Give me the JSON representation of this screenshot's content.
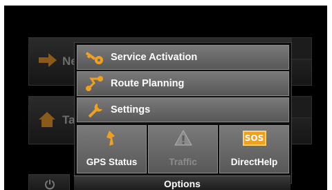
{
  "background": {
    "buttons": [
      {
        "label": "Ne",
        "icon": "arrow-right-icon"
      },
      {
        "label": "Ta",
        "icon": "home-icon"
      }
    ],
    "bottom_icon": "power-icon"
  },
  "popup": {
    "rows": [
      {
        "label": "Service Activation",
        "icon": "key-icon"
      },
      {
        "label": "Route Planning",
        "icon": "route-icon"
      },
      {
        "label": "Settings",
        "icon": "wrench-icon"
      }
    ],
    "tiles": [
      {
        "label": "GPS Status",
        "icon": "satellite-icon",
        "enabled": true
      },
      {
        "label": "Traffic",
        "icon": "warning-icon",
        "enabled": false
      },
      {
        "label": "DirectHelp",
        "icon": "sos-icon",
        "icon_text": "SOS",
        "enabled": true
      }
    ]
  },
  "options_bar": {
    "label": "Options"
  },
  "colors": {
    "accent": "#f0a020",
    "row": "#6a6a6a",
    "background": "#000000"
  }
}
